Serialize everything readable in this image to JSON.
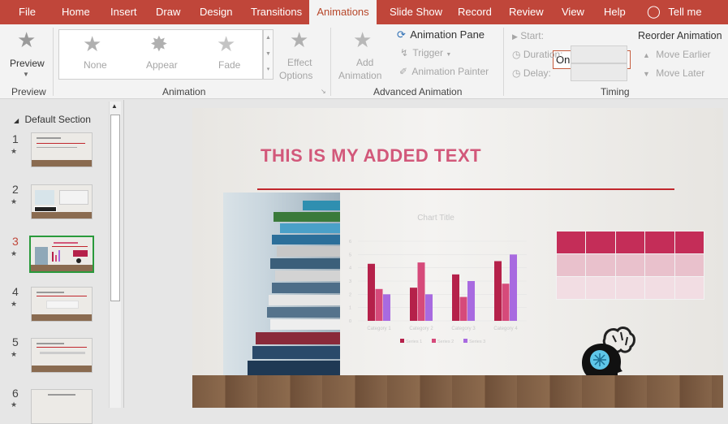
{
  "tabs": [
    "File",
    "Home",
    "Insert",
    "Draw",
    "Design",
    "Transitions",
    "Animations",
    "Slide Show",
    "Record",
    "Review",
    "View",
    "Help"
  ],
  "active_tab": "Animations",
  "tell_me": "Tell me",
  "ribbon": {
    "preview": {
      "button": "Preview",
      "group": "Preview"
    },
    "animation": {
      "gallery": [
        "None",
        "Appear",
        "Fade"
      ],
      "effect_options": [
        "Effect",
        "Options"
      ],
      "group": "Animation"
    },
    "advanced": {
      "add_animation": [
        "Add",
        "Animation"
      ],
      "animation_pane": "Animation Pane",
      "trigger": "Trigger",
      "animation_painter": "Animation Painter",
      "group": "Advanced Animation"
    },
    "timing": {
      "start_label": "Start:",
      "start_value": "On Click",
      "duration_label": "Duration:",
      "delay_label": "Delay:",
      "reorder": "Reorder Animation",
      "move_earlier": "Move Earlier",
      "move_later": "Move Later",
      "group": "Timing"
    }
  },
  "thumbnails": {
    "section": "Default Section",
    "slides": [
      {
        "num": "1",
        "selected": false
      },
      {
        "num": "2",
        "selected": false
      },
      {
        "num": "3",
        "selected": true
      },
      {
        "num": "4",
        "selected": false
      },
      {
        "num": "5",
        "selected": false
      },
      {
        "num": "6",
        "selected": false
      }
    ]
  },
  "slide": {
    "title": "THIS IS MY ADDED TEXT",
    "accent_color": "#c1272d",
    "title_color": "#d2587a"
  },
  "chart_data": {
    "type": "bar",
    "title": "Chart Title",
    "categories": [
      "Category 1",
      "Category 2",
      "Category 3",
      "Category 4"
    ],
    "series": [
      {
        "name": "Series 1",
        "values": [
          4.3,
          2.5,
          3.5,
          4.5
        ],
        "color": "#b5214a"
      },
      {
        "name": "Series 2",
        "values": [
          2.4,
          4.4,
          1.8,
          2.8
        ],
        "color": "#d64a7a"
      },
      {
        "name": "Series 3",
        "values": [
          2,
          2,
          3,
          5
        ],
        "color": "#a86ae0"
      }
    ],
    "ylim": [
      0,
      6
    ],
    "yticks": [
      "0",
      "1",
      "2",
      "3",
      "4",
      "5",
      "6"
    ],
    "legend": "bottom"
  }
}
